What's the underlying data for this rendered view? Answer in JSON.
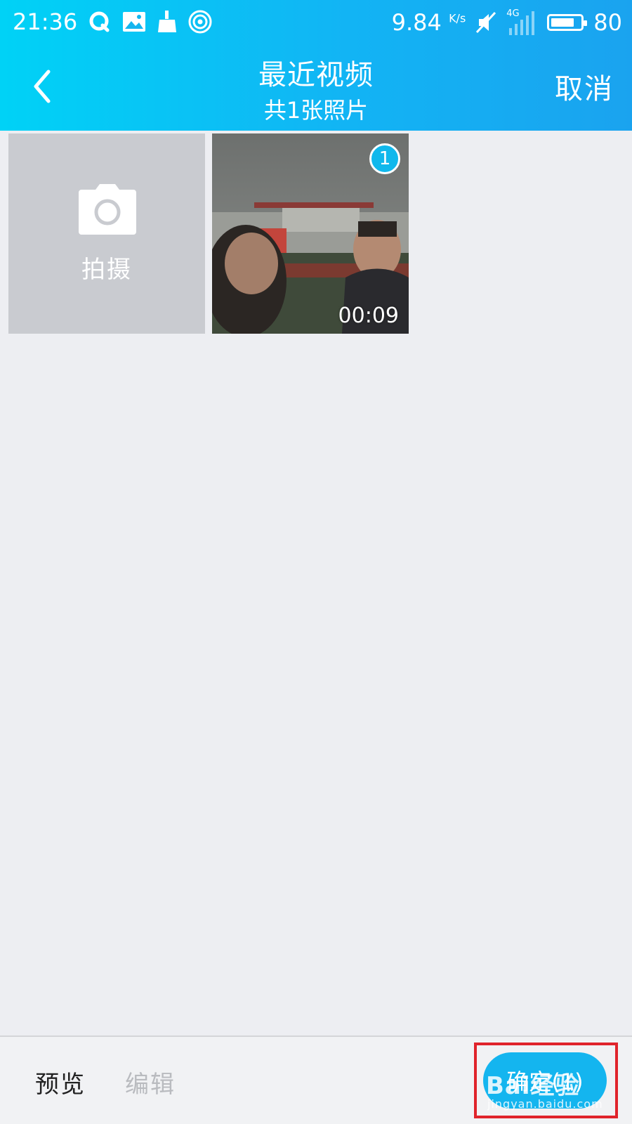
{
  "status_bar": {
    "time": "21:36",
    "speed_value": "9.84",
    "speed_unit": "K/s",
    "network": "4G",
    "battery": "80",
    "battery_level": 0.8,
    "icons": [
      "qq-icon",
      "image-icon",
      "cleaner-icon",
      "hotspot-icon",
      "mute-icon",
      "signal-icon",
      "battery-icon"
    ]
  },
  "header": {
    "title": "最近视频",
    "subtitle": "共1张照片",
    "cancel_label": "取消",
    "back_icon": "chevron-left-icon"
  },
  "grid": {
    "camera_tile": {
      "label": "拍摄",
      "icon": "camera-icon"
    },
    "video_tile": {
      "selected_index": "1",
      "duration": "00:09"
    }
  },
  "bottom_bar": {
    "preview_label": "预览",
    "edit_label": "编辑",
    "confirm_label": "确定(1)"
  },
  "watermark": {
    "brand": "Bai经验",
    "url": "jingyan.baidu.com"
  },
  "colors": {
    "header_gradient_start": "#00d2f6",
    "header_gradient_end": "#1aa3ef",
    "accent": "#14b5ef",
    "highlight": "#e0242b",
    "background": "#edeef2"
  }
}
